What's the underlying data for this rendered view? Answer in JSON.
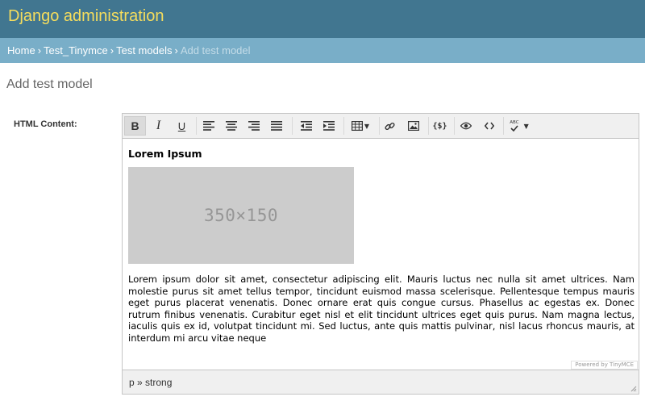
{
  "header": {
    "site_title": "Django administration"
  },
  "breadcrumbs": {
    "home": "Home",
    "app": "Test_Tinymce",
    "model": "Test models",
    "current": "Add test model",
    "separator": "›"
  },
  "page": {
    "title": "Add test model"
  },
  "form": {
    "field_label": "HTML Content:"
  },
  "editor": {
    "toolbar_icons": [
      "bold-icon",
      "italic-icon",
      "underline-icon",
      "align-left-icon",
      "align-center-icon",
      "align-right-icon",
      "align-justify-icon",
      "outdent-icon",
      "indent-icon",
      "table-icon",
      "link-icon",
      "image-icon",
      "template-variable-icon",
      "preview-icon",
      "source-code-icon",
      "spellcheck-icon"
    ],
    "bold_label": "B",
    "italic_label": "I",
    "underline_label": "U",
    "template_label": "{$}",
    "spellcheck_label": "ABC",
    "content": {
      "heading": "Lorem Ipsum",
      "image_text": "350×150",
      "paragraph": "Lorem ipsum dolor sit amet, consectetur adipiscing elit. Mauris luctus nec nulla sit amet ultrices. Nam molestie purus sit amet tellus tempor, tincidunt euismod massa scelerisque. Pellentesque tempus mauris eget purus placerat venenatis. Donec ornare erat quis congue cursus. Phasellus ac egestas ex. Donec rutrum finibus venenatis. Curabitur eget nisl et elit tincidunt ultrices eget quis purus. Nam magna lectus, iaculis quis ex id, volutpat tincidunt mi. Sed luctus, ante quis mattis pulvinar, nisl lacus rhoncus mauris, at interdum mi arcu vitae neque"
    },
    "powered_by": "Powered by TinyMCE",
    "statusbar_path": "p » strong"
  },
  "colors": {
    "header_bg": "#417690",
    "title_color": "#f5dd5d",
    "breadcrumb_bg": "#79aec8"
  }
}
